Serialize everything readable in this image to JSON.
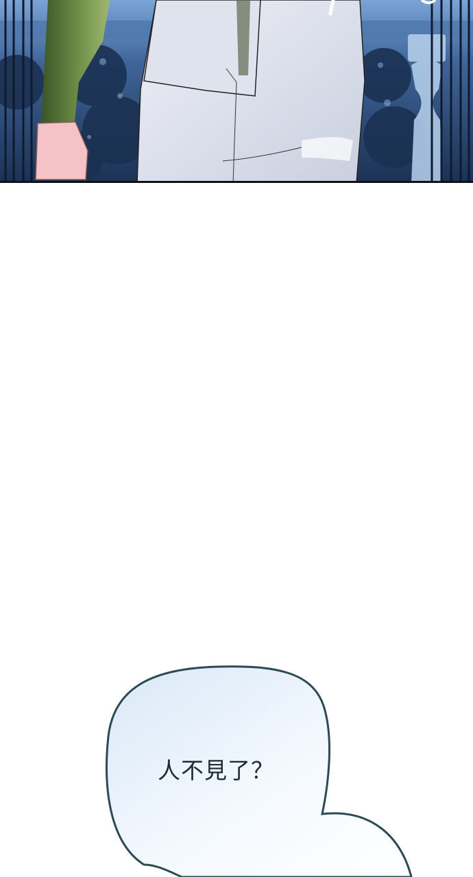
{
  "panel": {
    "description_colors": {
      "sky": "#6e98c9",
      "foliage": "#1d3558",
      "sleeve": "#4e6a33",
      "shirt": "#d7dbe8",
      "border": "#111111"
    }
  },
  "speech_bubble": {
    "text": "人不見了？",
    "outline_color": "#2c4a52",
    "fill_color": "#eef5fc"
  }
}
